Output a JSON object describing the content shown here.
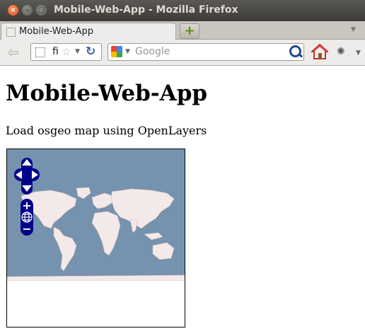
{
  "window": {
    "title": "Mobile-Web-App - Mozilla Firefox",
    "buttons": {
      "close": "×",
      "minimize": "–",
      "maximize": "□"
    }
  },
  "tabs": [
    {
      "label": "Mobile-Web-App",
      "active": true
    }
  ],
  "newtab": {
    "label": "+"
  },
  "navbar": {
    "back_label": "⇦",
    "url_value": "fi",
    "search_placeholder": "Google",
    "icons": [
      "back-arrow-icon",
      "page-identity-icon",
      "star-icon",
      "reload-icon",
      "google-icon",
      "search-icon",
      "home-icon",
      "addon-icon"
    ]
  },
  "page": {
    "heading": "Mobile-Web-App",
    "paragraph": "Load osgeo map using OpenLayers"
  },
  "map": {
    "controls": [
      "pan-up",
      "pan-left",
      "pan-right",
      "pan-down",
      "zoom-in",
      "zoom-world",
      "zoom-out"
    ],
    "colors": {
      "ocean": "#7593ae",
      "land": "#f3e9e9",
      "control": "#00008b"
    }
  }
}
